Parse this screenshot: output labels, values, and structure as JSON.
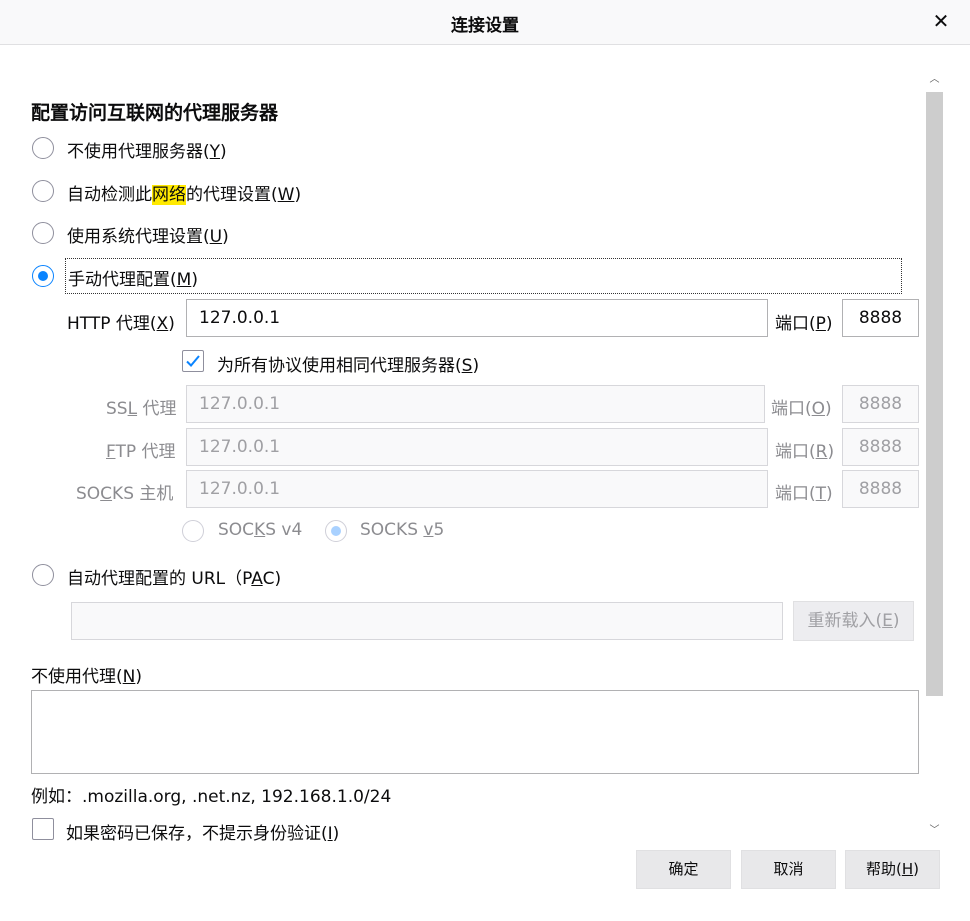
{
  "window": {
    "title": "连接设置"
  },
  "section": {
    "heading": "配置访问互联网的代理服务器"
  },
  "options": {
    "no_proxy": {
      "text": "不使用代理服务器(",
      "key": "Y",
      "tail": ")"
    },
    "auto_detect": {
      "pre": "自动检测此",
      "highlight": "网络",
      "post": "的代理设置(",
      "key": "W",
      "tail": ")"
    },
    "system": {
      "text": "使用系统代理设置(",
      "key": "U",
      "tail": ")"
    },
    "manual": {
      "text": "手动代理配置(",
      "key": "M",
      "tail": ")"
    },
    "pac": {
      "text": "自动代理配置的 URL（P",
      "key": "A",
      "tail": "C)"
    }
  },
  "http": {
    "label_pre": "HTTP 代理(",
    "label_key": "X",
    "label_tail": ")",
    "value": "127.0.0.1",
    "port_pre": "端口(",
    "port_key": "P",
    "port_tail": ")",
    "port": "8888"
  },
  "same_proxy": {
    "text": "为所有协议使用相同代理服务器(",
    "key": "S",
    "tail": ")"
  },
  "ssl": {
    "label_pre": "SS",
    "label_key": "L",
    "label_tail": " 代理",
    "value": "127.0.0.1",
    "port_pre": "端口(",
    "port_key": "O",
    "port_tail": ")",
    "port": "8888"
  },
  "ftp": {
    "label_pre": "",
    "label_key": "F",
    "label_tail": "TP 代理",
    "value": "127.0.0.1",
    "port_pre": "端口(",
    "port_key": "R",
    "port_tail": ")",
    "port": "8888"
  },
  "socks": {
    "label_pre": "SO",
    "label_key": "C",
    "label_tail": "KS 主机",
    "value": "127.0.0.1",
    "port_pre": "端口(",
    "port_key": "T",
    "port_tail": ")",
    "port": "8888",
    "v4_pre": "SOC",
    "v4_key": "K",
    "v4_tail": "S v4",
    "v5_pre": "SOCKS ",
    "v5_key": "v",
    "v5_tail": "5"
  },
  "pac": {
    "url": "",
    "reload_pre": "重新载入(",
    "reload_key": "E",
    "reload_tail": ")"
  },
  "no_proxy_for": {
    "pre": "不使用代理(",
    "key": "N",
    "tail": ")",
    "value": ""
  },
  "example": "例如：.mozilla.org, .net.nz, 192.168.1.0/24",
  "auth": {
    "text": "如果密码已保存，不提示身份验证(",
    "key": "I",
    "tail": ")"
  },
  "buttons": {
    "ok": "确定",
    "cancel": "取消",
    "help_pre": "帮助(",
    "help_key": "H",
    "help_tail": ")"
  },
  "colors": {
    "accent": "#0a84ff",
    "highlight": "#ffe900"
  },
  "icons": {
    "close": "close-icon",
    "check": "checkmark-icon",
    "scroll_up": "chevron-up-icon",
    "scroll_down": "chevron-down-icon"
  }
}
